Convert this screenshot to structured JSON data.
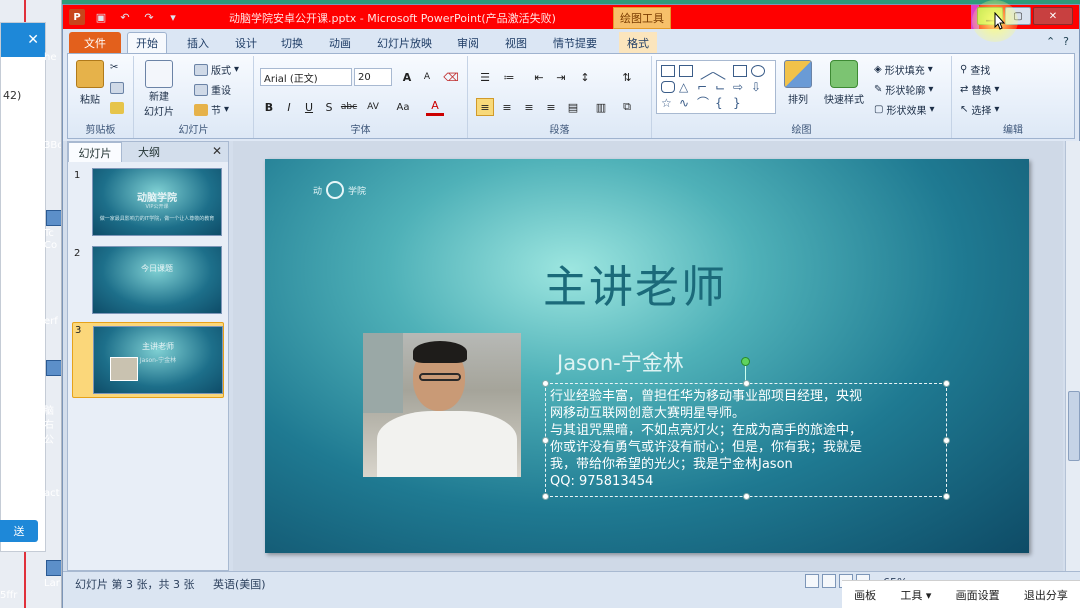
{
  "left_bg": {
    "num": "42)",
    "send_label": "送",
    "desk_items": [
      "he",
      "3Bc",
      "Tc",
      "Co",
      "erf",
      "脑",
      "右公",
      "act",
      "Lar",
      "5ffr"
    ]
  },
  "window": {
    "title": "动脑学院安卓公开课.pptx - Microsoft PowerPoint(产品激活失败)",
    "contextual_tab": "绘图工具",
    "ppt_icon": "P"
  },
  "tabs": [
    "文件",
    "开始",
    "插入",
    "设计",
    "切换",
    "动画",
    "幻灯片放映",
    "审阅",
    "视图",
    "情节提要",
    "格式"
  ],
  "ribbon": {
    "clipboard": {
      "paste": "粘贴",
      "label": "剪贴板"
    },
    "slides": {
      "new_slide_line1": "新建",
      "new_slide_line2": "幻灯片",
      "layout": "版式",
      "reset": "重设",
      "section": "节",
      "label": "幻灯片"
    },
    "font": {
      "font_name": "Arial (正文)",
      "font_size": "20",
      "bold": "B",
      "italic": "I",
      "underline": "U",
      "shadow": "S",
      "strike": "abc",
      "spacing": "AV",
      "case": "Aa",
      "color": "A",
      "grow": "A",
      "shrink": "A",
      "label": "字体"
    },
    "paragraph": {
      "label": "段落"
    },
    "drawing": {
      "arrange": "排列",
      "quick_styles": "快速样式",
      "shape_fill": "形状填充",
      "shape_outline": "形状轮廓",
      "shape_effects": "形状效果",
      "label": "绘图"
    },
    "editing": {
      "find": "查找",
      "replace": "替换",
      "select": "选择",
      "label": "编辑"
    }
  },
  "left_pane": {
    "tab_slides": "幻灯片",
    "tab_outline": "大纲",
    "thumbs": [
      {
        "num": "1",
        "title": "动脑学院",
        "sub1": "VIP公开课",
        "sub2": "做一家最具影响力的IT学院，做一个让人尊敬的教育"
      },
      {
        "num": "2",
        "title": "今日课题"
      },
      {
        "num": "3",
        "title": "主讲老师",
        "sub1": "Jason-宁金林"
      }
    ]
  },
  "slide": {
    "logo_left": "动",
    "logo_right": "学院",
    "heading": "主讲老师",
    "name": "Jason-宁金林",
    "body_lines": [
      "行业经验丰富，曾担任华为移动事业部项目经理，央视",
      "网移动互联网创意大赛明星导师。",
      "与其诅咒黑暗，不如点亮灯火；在成为高手的旅途中，",
      "你或许没有勇气或许没有耐心；但是，你有我；我就是",
      "我，带给你希望的光火；我是宁金林Jason",
      "QQ: 975813454"
    ]
  },
  "status": {
    "slide_info": "幻灯片 第 3 张，共 3 张",
    "language": "英语(美国)",
    "zoom": "65%"
  },
  "overlay_bar": [
    "画板",
    "工具 ▾",
    "画面设置",
    "退出分享"
  ]
}
